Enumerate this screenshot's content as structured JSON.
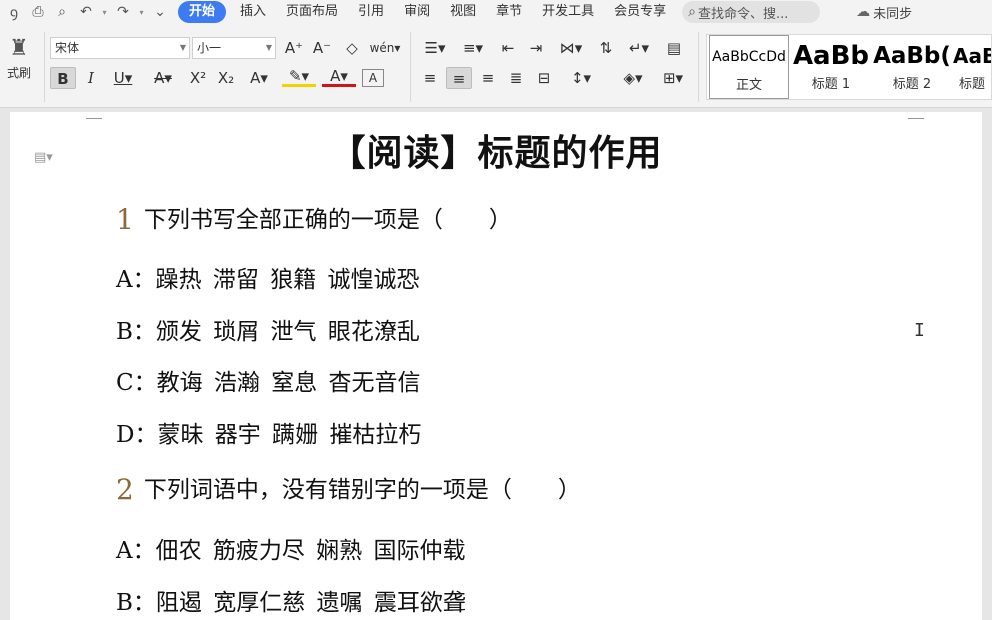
{
  "menubar": {
    "tabs": [
      "开始",
      "插入",
      "页面布局",
      "引用",
      "审阅",
      "视图",
      "章节",
      "开发工具",
      "会员专享"
    ],
    "search_placeholder": "查找命令、搜...",
    "cloud_status": "未同步"
  },
  "ribbon": {
    "format_painter_label": "式刷",
    "font_name": "宋体",
    "font_size": "小一",
    "styles": [
      {
        "sample": "AaBbCcDd",
        "name": "正文"
      },
      {
        "sample": "AaBb",
        "name": "标题 1"
      },
      {
        "sample": "AaBb(",
        "name": "标题 2"
      },
      {
        "sample": "AaB",
        "name": "标题"
      }
    ]
  },
  "document": {
    "title": "【阅读】标题的作用",
    "questions": [
      {
        "number": "1",
        "text": "下列书写全部正确的一项是（　　）",
        "options": [
          "A：躁热 滞留 狼籍 诚惶诚恐",
          "B：颁发 琐屑 泄气 眼花潦乱",
          "C：教诲 浩瀚 窒息 杳无音信",
          "D：蒙昧 器宇 蹒姗 摧枯拉朽"
        ]
      },
      {
        "number": "2",
        "text": "下列词语中，没有错别字的一项是（　　）",
        "options": [
          "A：佃农 筋疲力尽 娴熟 国际仲载",
          "B：阻遏 宽厚仁慈 遗嘱 震耳欲聋"
        ]
      }
    ]
  }
}
